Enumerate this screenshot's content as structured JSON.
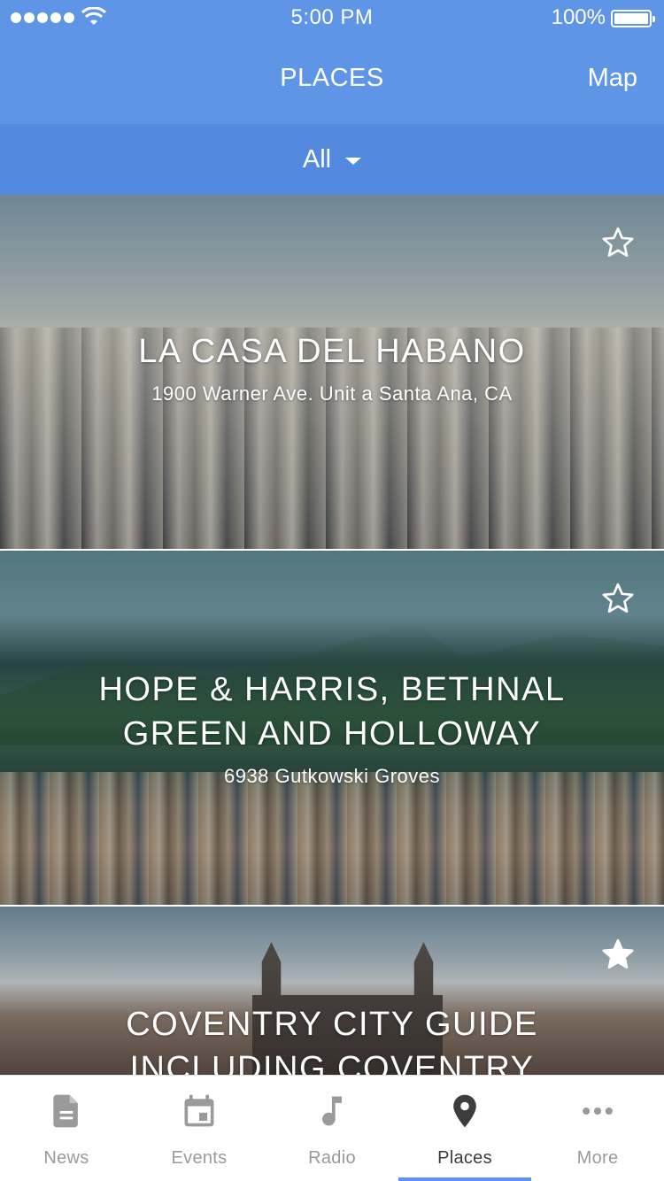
{
  "status_bar": {
    "time": "5:00 PM",
    "battery": "100%"
  },
  "header": {
    "title": "PLACES",
    "map_button": "Map"
  },
  "filter": {
    "selected": "All"
  },
  "places": [
    {
      "title": "LA CASA DEL HABANO",
      "address": "1900 Warner Ave. Unit a Santa Ana, CA",
      "favorite": false
    },
    {
      "title": "HOPE & HARRIS, BETHNAL GREEN AND HOLLOWAY",
      "address": "6938 Gutkowski Groves",
      "favorite": false
    },
    {
      "title": "COVENTRY CITY GUIDE INCLUDING COVENTRY",
      "address": "",
      "favorite": true
    }
  ],
  "tabs": [
    {
      "label": "News",
      "icon": "document-icon",
      "active": false
    },
    {
      "label": "Events",
      "icon": "calendar-icon",
      "active": false
    },
    {
      "label": "Radio",
      "icon": "music-note-icon",
      "active": false
    },
    {
      "label": "Places",
      "icon": "map-pin-icon",
      "active": true
    },
    {
      "label": "More",
      "icon": "more-dots-icon",
      "active": false
    }
  ],
  "colors": {
    "header_bg": "#5f95e6",
    "filter_bg": "#5489e0",
    "tab_active": "#3d3d3d",
    "tab_inactive": "#9a9a9a"
  }
}
